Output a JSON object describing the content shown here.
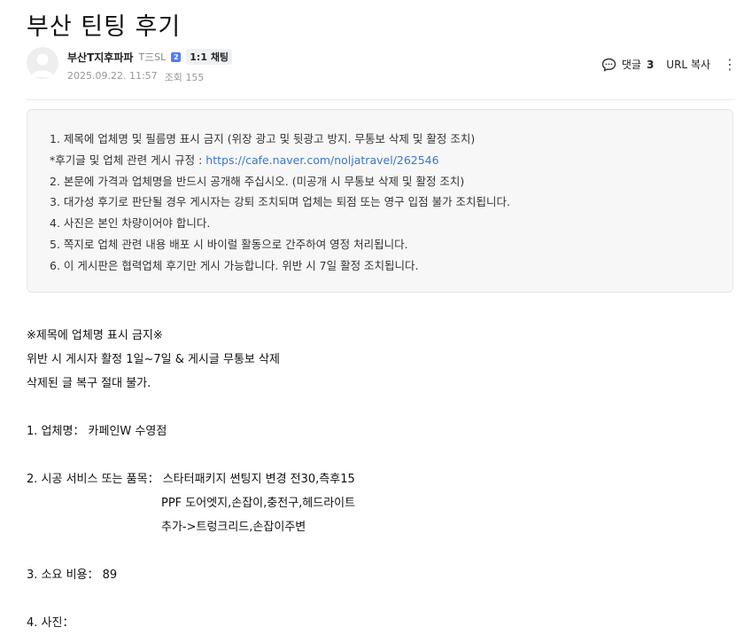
{
  "post": {
    "title": "부산 틴팅 후기",
    "author": {
      "name": "부산T지후파파",
      "grade": "T三SL",
      "grade_badge": "2",
      "chat_label": "1:1 채팅"
    },
    "meta": {
      "date": "2025.09.22. 11:57",
      "views_label": "조회",
      "views": "155"
    },
    "tools": {
      "comment_label": "댓글",
      "comment_count": "3",
      "url_copy_label": "URL 복사"
    }
  },
  "notice": {
    "line1": "1. 제목에 업체명 및 필름명 표시 금지 (위장 광고 및 뒷광고 방지. 무통보 삭제 및 활정 조치)",
    "line2_prefix": "*후기글 및 업체 관련 게시 규정 : ",
    "line2_link": "https://cafe.naver.com/noljatravel/262546",
    "line3": "2. 본문에 가격과 업체명을 반드시 공개해 주십시오. (미공개 시 무통보 삭제 및 활정 조치)",
    "line4": "3. 대가성 후기로 판단될 경우 게시자는 강퇴 조치되며 업체는 퇴점 또는 영구 입점 불가 조치됩니다.",
    "line5": "4. 사진은 본인 차량이어야 합니다.",
    "line6": "5. 쪽지로 업체 관련 내용 배포 시 바이럴 활동으로 간주하여 영정 처리됩니다.",
    "line7": "6. 이 게시판은 협력업체 후기만 게시 가능합니다. 위반 시 7일 활정 조치됩니다."
  },
  "body": {
    "warn1": "※제목에 업체명 표시 금지※",
    "warn2": "위반 시 게시자 활정 1일~7일 & 게시글 무통보 삭제",
    "warn3": "삭제된 글 복구 절대 불가.",
    "item1": "1. 업체명： 카페인W 수영점",
    "item2": "2. 시공 서비스 또는 품목： 스타터패키지 썬팅지 변경 전30,측후15",
    "item2b": "PPF 도어엣지,손잡이,충전구,헤드라이트",
    "item2c": "추가->트렁크리드,손잡이주변",
    "item3": "3. 소요 비용： 89",
    "item4": "4. 사진："
  }
}
